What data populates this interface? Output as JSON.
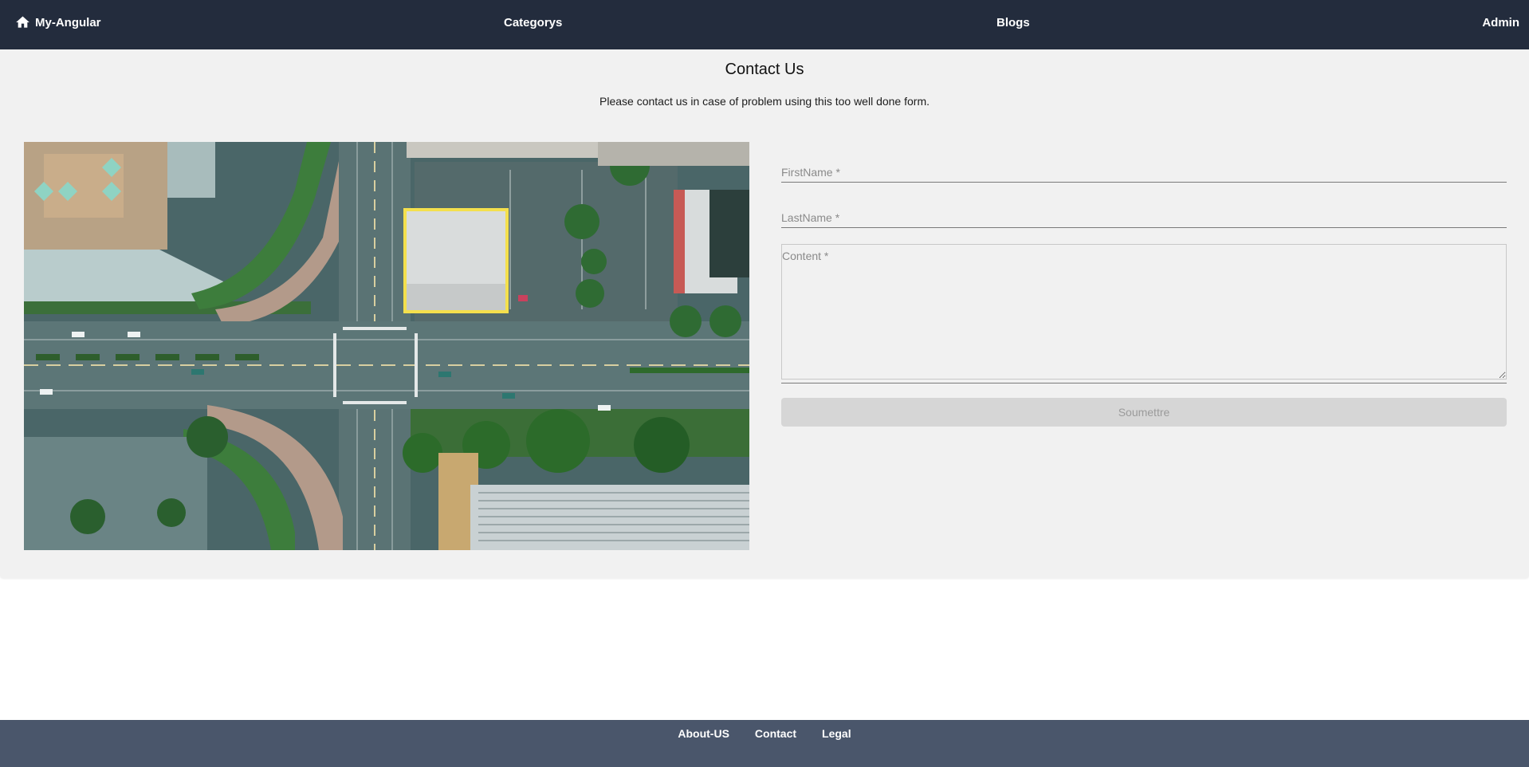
{
  "navbar": {
    "brand_icon": "home-icon",
    "brand_label": "My-Angular",
    "links": {
      "categorys": "Categorys",
      "blogs": "Blogs",
      "admin": "Admin"
    }
  },
  "page": {
    "title": "Contact Us",
    "subtitle": "Please contact us in case of problem using this too well done form."
  },
  "image": {
    "description": "aerial-street-intersection-photo"
  },
  "form": {
    "firstname_placeholder": "FirstName *",
    "firstname_value": "",
    "lastname_placeholder": "LastName *",
    "lastname_value": "",
    "content_placeholder": "Content *",
    "content_value": "",
    "submit_label": "Soumettre"
  },
  "footer": {
    "links": {
      "about": "About-US",
      "contact": "Contact",
      "legal": "Legal"
    }
  },
  "colors": {
    "navbar_bg": "#232c3d",
    "footer_bg": "#4a566b",
    "card_bg": "#f1f1f1",
    "button_disabled_bg": "#d6d6d6",
    "button_disabled_text": "#9b9b9b",
    "highlight_yellow": "#f4e04d"
  }
}
